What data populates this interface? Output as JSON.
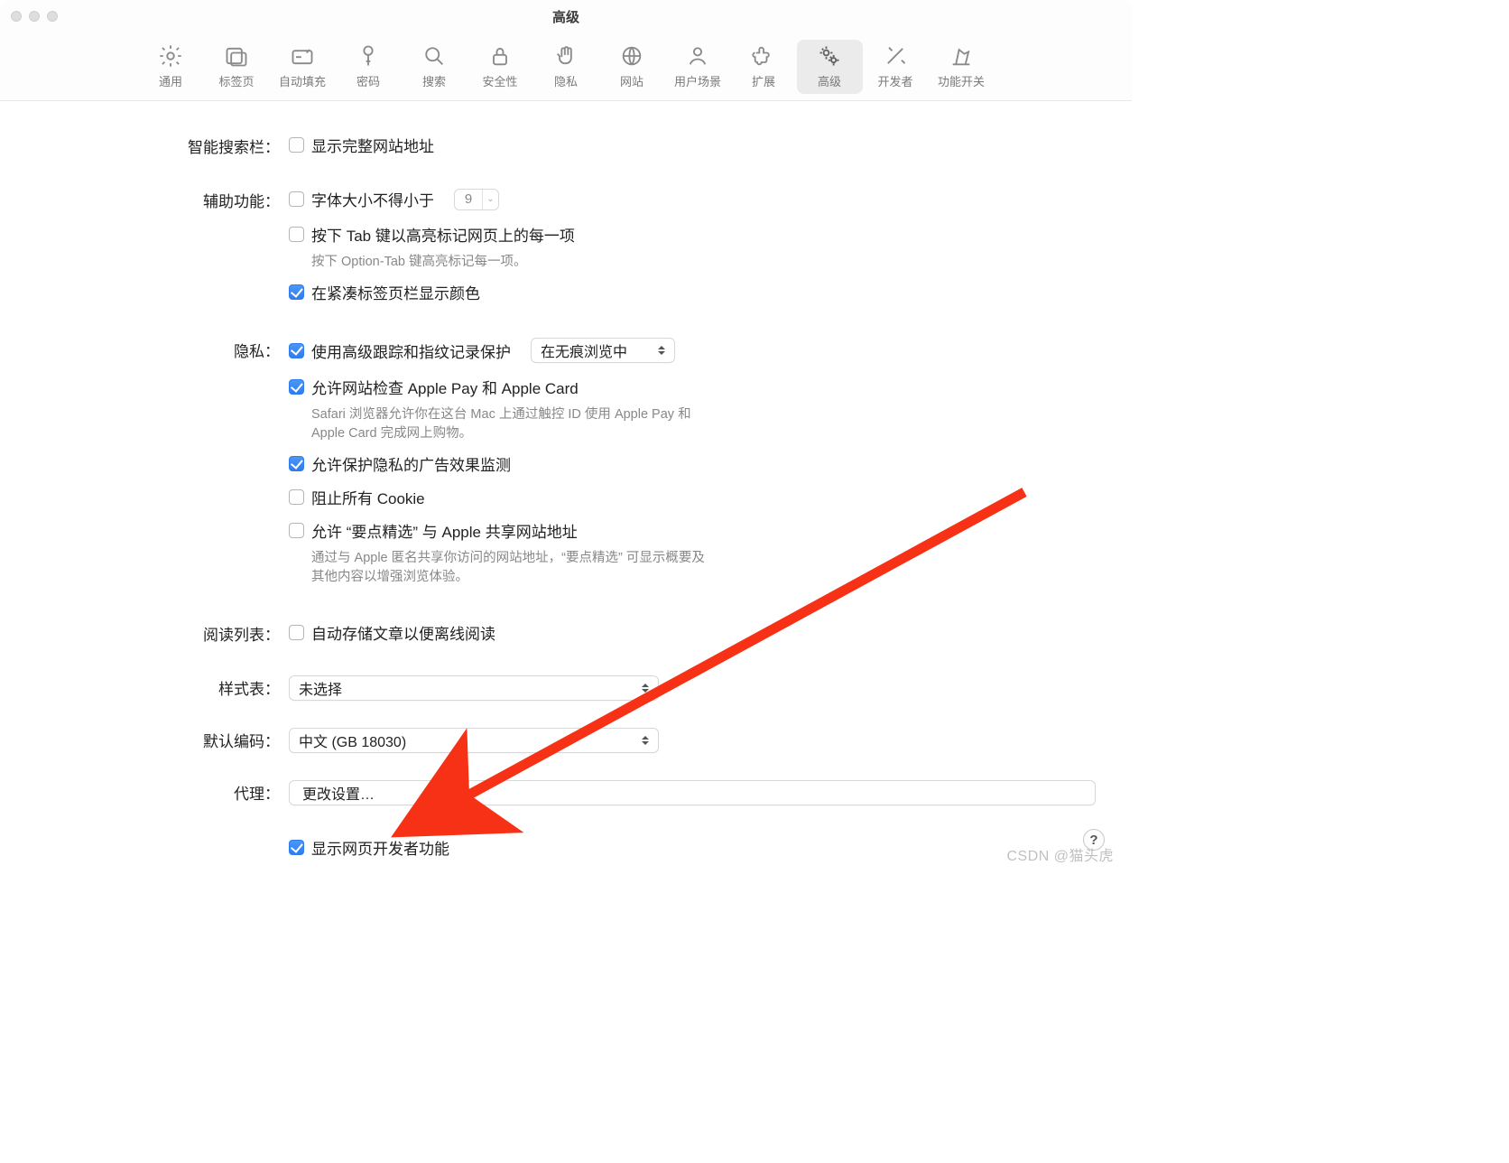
{
  "window": {
    "title": "高级"
  },
  "toolbar": {
    "items": [
      {
        "id": "general",
        "label": "通用",
        "icon": "gear-icon"
      },
      {
        "id": "tabs",
        "label": "标签页",
        "icon": "tabs-icon"
      },
      {
        "id": "autofill",
        "label": "自动填充",
        "icon": "autofill-icon"
      },
      {
        "id": "passwords",
        "label": "密码",
        "icon": "key-icon"
      },
      {
        "id": "search",
        "label": "搜索",
        "icon": "search-icon"
      },
      {
        "id": "security",
        "label": "安全性",
        "icon": "lock-icon"
      },
      {
        "id": "privacy",
        "label": "隐私",
        "icon": "hand-icon"
      },
      {
        "id": "websites",
        "label": "网站",
        "icon": "globe-icon"
      },
      {
        "id": "profiles",
        "label": "用户场景",
        "icon": "profile-icon"
      },
      {
        "id": "extensions",
        "label": "扩展",
        "icon": "puzzle-icon"
      },
      {
        "id": "advanced",
        "label": "高级",
        "icon": "gears-icon",
        "active": true
      },
      {
        "id": "developer",
        "label": "开发者",
        "icon": "tools-icon"
      },
      {
        "id": "flags",
        "label": "功能开关",
        "icon": "flags-icon"
      }
    ]
  },
  "sections": {
    "smartSearch": {
      "label": "智能搜索栏：",
      "showFullAddress": "显示完整网站地址"
    },
    "accessibility": {
      "label": "辅助功能：",
      "minFontLabel": "字体大小不得小于",
      "minFontValue": "9",
      "tabHighlightLabel": "按下 Tab 键以高亮标记网页上的每一项",
      "tabHighlightHint": "按下 Option-Tab 键高亮标记每一项。",
      "compactTabColorLabel": "在紧凑标签页栏显示颜色"
    },
    "privacy": {
      "label": "隐私：",
      "trackingLabel": "使用高级跟踪和指纹记录保护",
      "trackingSelect": "在无痕浏览中",
      "applePayLabel": "允许网站检查 Apple Pay 和 Apple Card",
      "applePayHint": "Safari 浏览器允许你在这台 Mac 上通过触控 ID 使用 Apple Pay 和 Apple Card 完成网上购物。",
      "adMeasureLabel": "允许保护隐私的广告效果监测",
      "blockCookiesLabel": "阻止所有 Cookie",
      "shareHighlightsLabel": "允许 “要点精选” 与 Apple 共享网站地址",
      "shareHighlightsHint": "通过与 Apple 匿名共享你访问的网站地址，“要点精选” 可显示概要及其他内容以增强浏览体验。"
    },
    "readingList": {
      "label": "阅读列表：",
      "autoSaveOffline": "自动存储文章以便离线阅读"
    },
    "stylesheet": {
      "label": "样式表：",
      "value": "未选择"
    },
    "encoding": {
      "label": "默认编码：",
      "value": "中文 (GB 18030)"
    },
    "proxy": {
      "label": "代理：",
      "button": "更改设置…"
    },
    "developer": {
      "showDevMenu": "显示网页开发者功能"
    }
  },
  "help": "?",
  "watermark": "CSDN @猫头虎"
}
